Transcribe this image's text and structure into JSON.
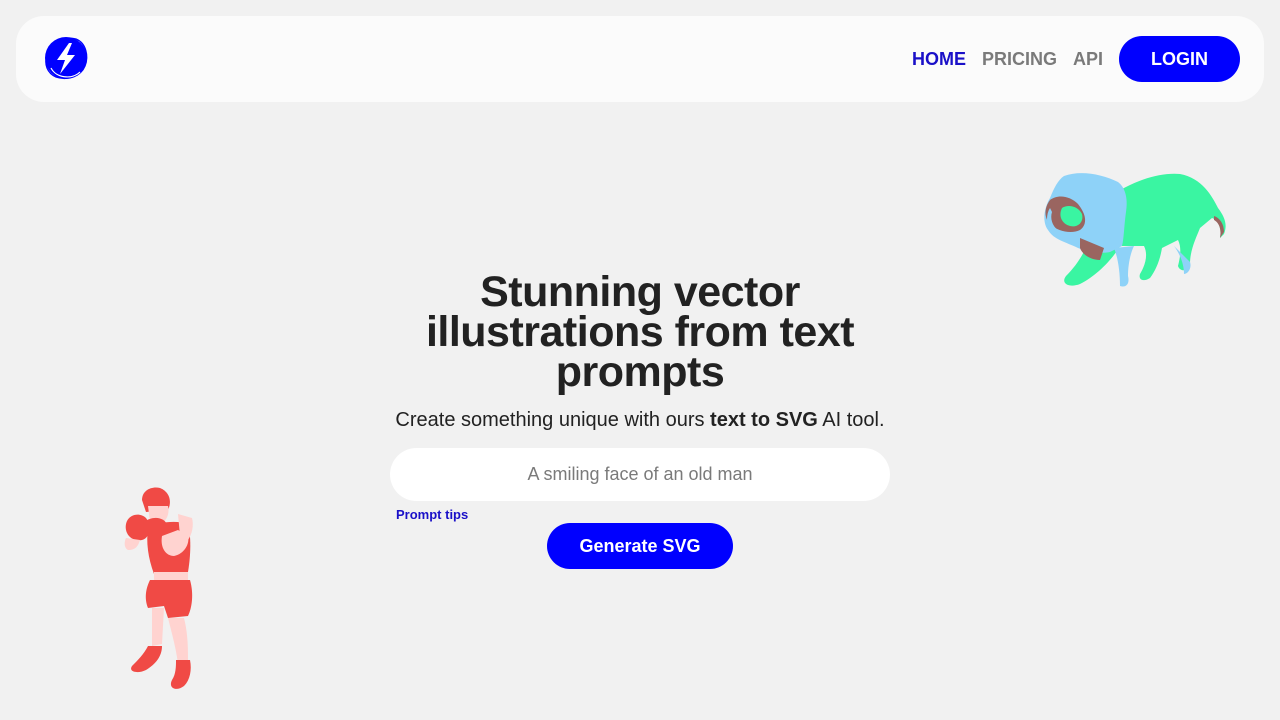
{
  "nav": {
    "logo_icon": "lightning-bolt-icon",
    "links": [
      {
        "label": "HOME",
        "active": true
      },
      {
        "label": "PRICING",
        "active": false
      },
      {
        "label": "API",
        "active": false
      }
    ],
    "login_label": "LOGIN"
  },
  "hero": {
    "title": "Stunning vector illustrations from text prompts",
    "subtitle_prefix": "Create something unique with ours ",
    "subtitle_bold": "text to SVG",
    "subtitle_suffix": " AI tool.",
    "input_placeholder": "A smiling face of an old man",
    "input_value": "",
    "prompt_tips_label": "Prompt tips",
    "generate_label": "Generate SVG"
  },
  "colors": {
    "accent": "#0000ff",
    "active_link": "#1a10c8",
    "background": "#f1f1f1",
    "nav_background": "#fbfbfb",
    "text": "#222222",
    "muted": "#7a7a7a"
  },
  "illustrations": {
    "right": "lion-illustration",
    "left": "boxer-illustration"
  }
}
